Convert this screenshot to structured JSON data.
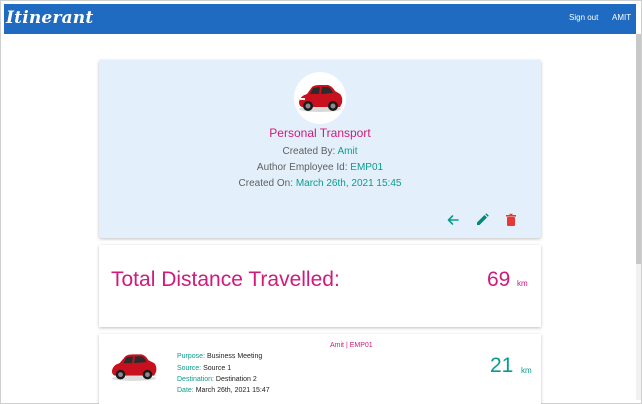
{
  "navbar": {
    "brand": "Itinerant",
    "signout": "Sign out",
    "user": "AMIT",
    "bg": "#1f6bc2"
  },
  "profile": {
    "title": "Personal Transport",
    "created_by_label": "Created By:",
    "created_by": "Amit",
    "employee_label": "Author Employee Id:",
    "employee_id": "EMP01",
    "created_on_label": "Created On:",
    "created_on": "March 26th, 2021 15:45",
    "actions": [
      "arrow-left-icon",
      "pencil-icon",
      "trash-icon"
    ]
  },
  "distance": {
    "label": "Total Distance Travelled:",
    "value": "69",
    "unit": "km"
  },
  "trip": {
    "header": "Amit | EMP01",
    "purpose_label": "Purpose:",
    "purpose": "Business Meeting",
    "source_label": "Source:",
    "source": "Source 1",
    "destination_label": "Destination:",
    "destination": "Destination 2",
    "date_label": "Date:",
    "date": "March 26th, 2021 15:47",
    "distance": "21",
    "unit": "km"
  },
  "colors": {
    "accent_pink": "#d01a7c",
    "accent_teal": "#0b9b8e",
    "edit_green": "#00897b",
    "delete_red": "#e53935"
  }
}
